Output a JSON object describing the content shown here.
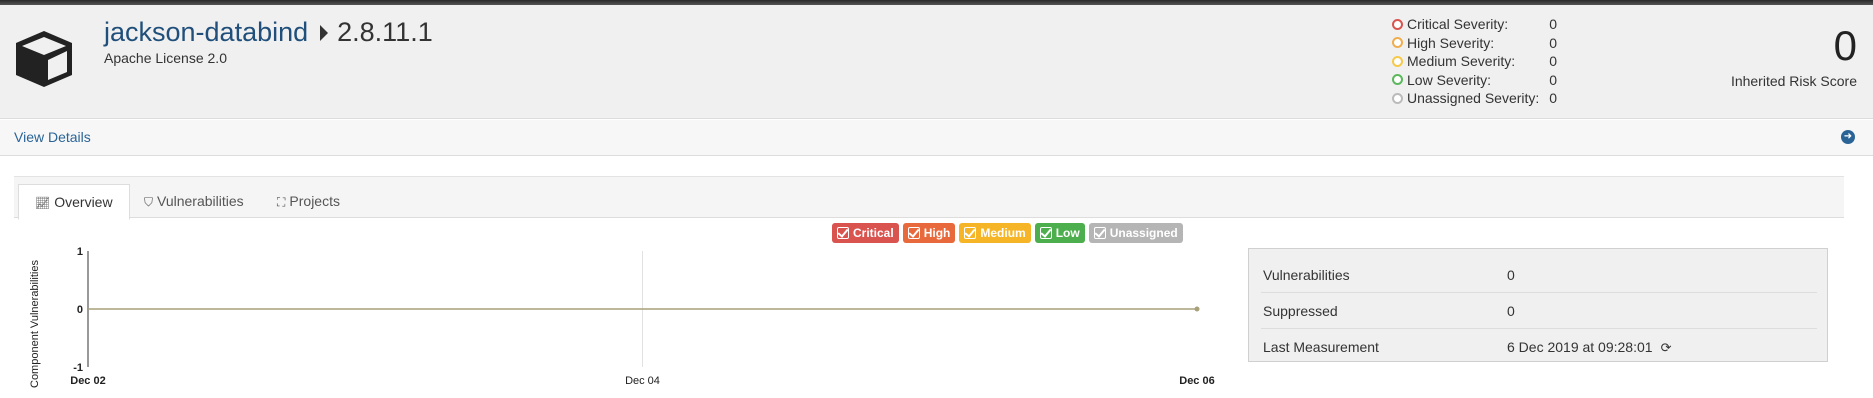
{
  "component": {
    "name": "jackson-databind",
    "version": "2.8.11.1",
    "license": "Apache License 2.0",
    "icon": "package-icon"
  },
  "severities": [
    {
      "label": "Critical Severity:",
      "value": "0",
      "color": "#d9534f"
    },
    {
      "label": "High Severity:",
      "value": "0",
      "color": "#f0ad4e"
    },
    {
      "label": "Medium Severity:",
      "value": "0",
      "color": "#f7c948"
    },
    {
      "label": "Low Severity:",
      "value": "0",
      "color": "#5cb85c"
    },
    {
      "label": "Unassigned Severity:",
      "value": "0",
      "color": "#bbbbbb"
    }
  ],
  "risk": {
    "score": "0",
    "label": "Inherited Risk Score"
  },
  "details": {
    "link": "View Details",
    "icon": "arrow-circle-right-icon"
  },
  "tabs": [
    {
      "label": "Overview",
      "icon": "line-chart-icon",
      "active": true
    },
    {
      "label": "Vulnerabilities",
      "icon": "shield-icon",
      "active": false
    },
    {
      "label": "Projects",
      "icon": "sitemap-icon",
      "active": false
    }
  ],
  "legend": [
    {
      "label": "Critical",
      "color": "#d9534f"
    },
    {
      "label": "High",
      "color": "#e8693c"
    },
    {
      "label": "Medium",
      "color": "#f5b526"
    },
    {
      "label": "Low",
      "color": "#4cae4c"
    },
    {
      "label": "Unassigned",
      "color": "#b5b5b5"
    }
  ],
  "chart_data": {
    "type": "line",
    "ylabel": "Component Vulnerabilities",
    "xlabel": "",
    "ylim": [
      -1,
      1
    ],
    "yticks": [
      "1",
      "0",
      "-1"
    ],
    "xticks": [
      "Dec 02",
      "Dec 04",
      "Dec 06"
    ],
    "series": [
      {
        "values": [
          0,
          0,
          0
        ]
      }
    ]
  },
  "stats": [
    {
      "label": "Vulnerabilities",
      "value": "0"
    },
    {
      "label": "Suppressed",
      "value": "0"
    },
    {
      "label": "Last Measurement",
      "value": "6 Dec 2019 at 09:28:01"
    }
  ]
}
